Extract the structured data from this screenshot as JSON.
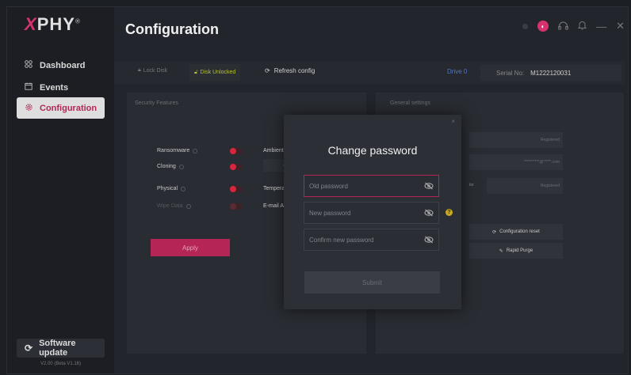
{
  "app": {
    "logo_text": "PHY",
    "logo_mark": "X",
    "logo_reg": "®"
  },
  "sidebar": {
    "items": [
      {
        "label": "Dashboard",
        "icon": "grid-icon"
      },
      {
        "label": "Events",
        "icon": "calendar-icon"
      },
      {
        "label": "Configuration",
        "icon": "gear-icon",
        "active": true
      }
    ],
    "update_label": "Software update",
    "version": "V2.00 (Beta V1.16)"
  },
  "header": {
    "title": "Configuration"
  },
  "toolbar": {
    "lock_label": "Lock Disk",
    "unlocked_label": "Disk Unlocked",
    "refresh_label": "Refresh config",
    "drive_label": "Drive 0",
    "serial_label": "Serial No:",
    "serial_value": "M1222120031"
  },
  "security": {
    "title": "Security Features",
    "rows": [
      {
        "label": "Ransomware"
      },
      {
        "label": "Cloning"
      },
      {
        "label": "Physical"
      },
      {
        "label": "Wipe Data"
      }
    ],
    "right_labels": [
      "Ambient",
      "Temperat",
      "E-mail Ale"
    ],
    "apply_label": "Apply"
  },
  "general": {
    "title": "General settings",
    "field1": "Registered",
    "field2": "**********@*****.com",
    "field3_label": "tor",
    "field3": "Registered",
    "reset_label": "Configuration reset",
    "purge_label": "Rapid Purge"
  },
  "modal": {
    "close": "×",
    "title": "Change password",
    "old_placeholder": "Old password",
    "new_placeholder": "New password",
    "confirm_placeholder": "Confirm new password",
    "help": "?",
    "submit_label": "Submit"
  },
  "colors": {
    "accent": "#b52556",
    "toggle_red": "#d8263e",
    "unlocked": "#b5c12f",
    "drive": "#4b78c7"
  }
}
